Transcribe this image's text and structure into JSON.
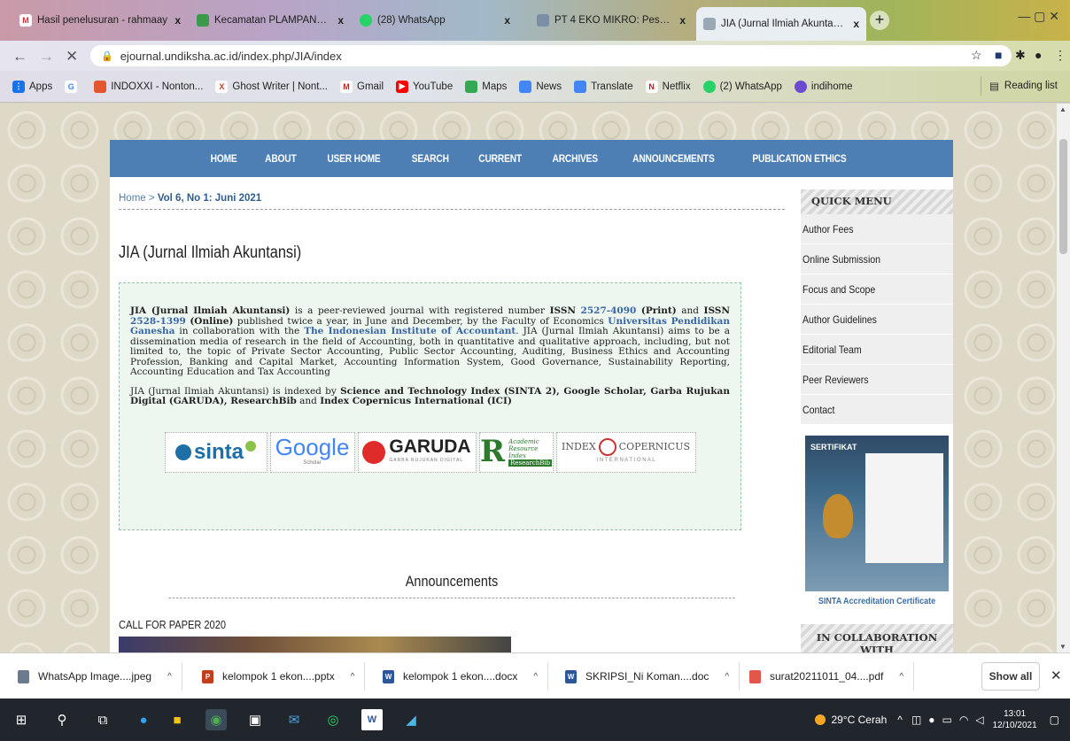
{
  "browser": {
    "tabs": [
      {
        "title": "Hasil penelusuran - rahmaay",
        "close": "x",
        "icon": "gmail-icon"
      },
      {
        "title": "Kecamatan PLAMPANG | Ge",
        "close": "x",
        "icon": "site-icon"
      },
      {
        "title": "(28) WhatsApp",
        "close": "x",
        "icon": "whatsapp-icon"
      },
      {
        "title": "PT 4 EKO MIKRO: Peserta",
        "close": "x",
        "icon": "doc-icon"
      },
      {
        "title": "JIA (Jurnal Ilmiah Akuntansi)",
        "close": "x",
        "icon": "journal-icon"
      }
    ],
    "new_tab": "+",
    "url": "ejournal.undiksha.ac.id/index.php/JIA/index",
    "bookmarks": [
      {
        "label": "Apps",
        "color": "#1a73e8"
      },
      {
        "label": "",
        "color": "#4285f4"
      },
      {
        "label": "INDOXXI - Nonton...",
        "color": "#e4572e"
      },
      {
        "label": "Ghost Writer | Nont...",
        "color": "#d93025"
      },
      {
        "label": "Gmail",
        "color": "#c5221f"
      },
      {
        "label": "YouTube",
        "color": "#ff0000"
      },
      {
        "label": "Maps",
        "color": "#34a853"
      },
      {
        "label": "News",
        "color": "#4285f4"
      },
      {
        "label": "Translate",
        "color": "#4285f4"
      },
      {
        "label": "Netflix",
        "color": "#e50914"
      },
      {
        "label": "(2) WhatsApp",
        "color": "#25d366"
      },
      {
        "label": "indihome",
        "color": "#6b4bd1"
      }
    ],
    "reading_list": "Reading list"
  },
  "site": {
    "nav": [
      "HOME",
      "ABOUT",
      "USER HOME",
      "SEARCH",
      "CURRENT",
      "ARCHIVES",
      "ANNOUNCEMENTS",
      "PUBLICATION ETHICS"
    ],
    "breadcrumb_home": "Home",
    "breadcrumb_sep": ">",
    "breadcrumb_current": "Vol 6, No 1: Juni 2021",
    "title": "JIA (Jurnal Ilmiah Akuntansi)",
    "intro": {
      "p1_a": "JIA (Jurnal Ilmiah Akuntansi)",
      "p1_b": " is a peer-reviewed journal with registered number ",
      "p1_issn1_label": "ISSN",
      "p1_issn1": "2527-4090",
      "p1_print": "(Print)",
      "p1_and": " and ",
      "p1_issn2_label": "ISSN",
      "p1_issn2": "2528-1399",
      "p1_online": "(Online)",
      "p1_c": " published twice a year, in June and December, by the Faculty of Economics ",
      "p1_univ": "Universitas Pendidikan Ganesha",
      "p1_d": " in collaboration with the ",
      "p1_inst": "The Indonesian Institute of Accountant",
      "p1_e": ". JIA (Jurnal Ilmiah Akuntansi) aims to be a dissemination media of research in the field of Accounting, both in quantitative and qualitative approach, including, but not limited to, the topic of Private Sector Accounting, Public Sector Accounting, Auditing, Business Ethics and Accounting Profession, Banking and Capital Market, Accounting Information System, Good Governance, Sustainability Reporting, Accounting Education and Tax Accounting",
      "p2_a": "JIA (Jurnal Ilmiah Akuntansi) is indexed by ",
      "p2_b": "Science and Technology Index (SINTA 2), Google Scholar, Garba Rujukan Digital (GARUDA), ResearchBib",
      "p2_c": " and ",
      "p2_d": "Index Copernicus International (ICI)"
    },
    "logos": {
      "sinta": "sinta",
      "google": "Google",
      "google_sub": "Scholar",
      "garuda": "GARUDA",
      "garuda_sub": "GARBA RUJUKAN DIGITAL",
      "researchbib_1": "Academic",
      "researchbib_2": "Resource",
      "researchbib_3": "Index",
      "researchbib_4": "ResearchBib",
      "copernicus_1": "INDEX",
      "copernicus_2": "COPERNICUS",
      "copernicus_3": "I N T E R N A T I O N A L"
    },
    "announcements_heading": "Announcements",
    "cfp_title": "CALL FOR PAPER 2020",
    "sidebar": {
      "quick_menu": "QUICK MENU",
      "items": [
        "Author Fees",
        "Online Submission",
        "Focus and Scope",
        "Author Guidelines",
        "Editorial Team",
        "Peer Reviewers",
        "Contact"
      ],
      "cert_label": "SERTIFIKAT",
      "cert_caption": "SINTA Accreditation Certificate",
      "collab_1": "IN COLLABORATION",
      "collab_2": "WITH"
    }
  },
  "downloads": {
    "items": [
      {
        "name": "WhatsApp Image....jpeg",
        "color": "#6b7a8f"
      },
      {
        "name": "kelompok 1 ekon....pptx",
        "color": "#c43e1c"
      },
      {
        "name": "kelompok 1 ekon....docx",
        "color": "#2b579a"
      },
      {
        "name": "SKRIPSI_Ni Koman....doc",
        "color": "#2b579a"
      },
      {
        "name": "surat20211011_04....pdf",
        "color": "#e2574c"
      }
    ],
    "caret": "^",
    "show_all": "Show all",
    "close": "✕"
  },
  "taskbar": {
    "weather": "29°C  Cerah",
    "time": "13:01",
    "date": "12/10/2021"
  }
}
